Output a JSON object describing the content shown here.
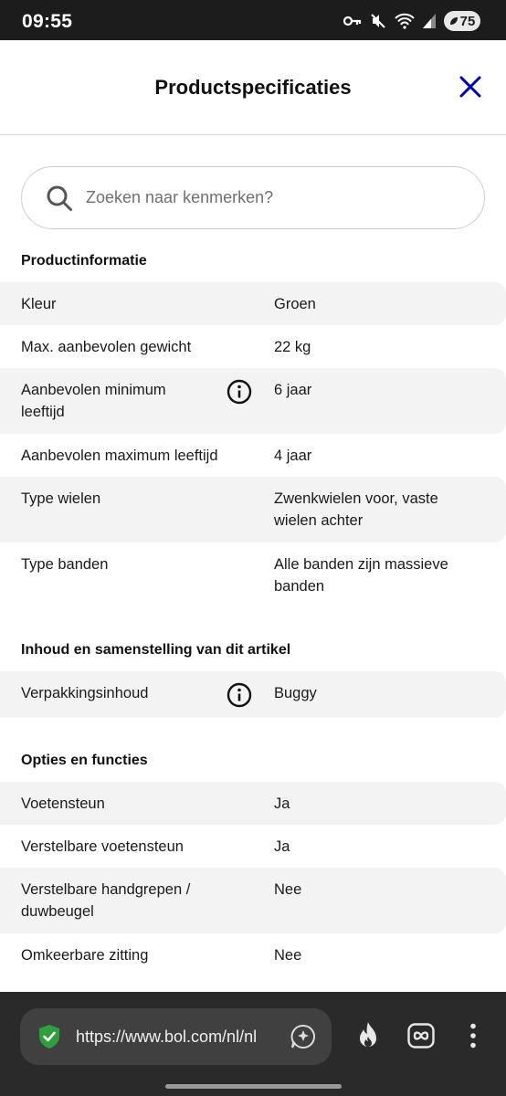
{
  "status_bar": {
    "time": "09:55",
    "battery": "75",
    "icons": [
      "key-icon",
      "mute-icon",
      "wifi-icon",
      "signal-icon",
      "battery-icon"
    ]
  },
  "header": {
    "title": "Productspecificaties",
    "close_icon": "close-icon"
  },
  "search": {
    "placeholder": "Zoeken naar kenmerken?",
    "value": ""
  },
  "sections": [
    {
      "heading": "Productinformatie",
      "rows": [
        {
          "label": "Kleur",
          "value": "Groen",
          "info": false
        },
        {
          "label": "Max. aanbevolen gewicht",
          "value": "22 kg",
          "info": false
        },
        {
          "label": "Aanbevolen minimum leeftijd",
          "value": "6 jaar",
          "info": true
        },
        {
          "label": "Aanbevolen maximum leeftijd",
          "value": "4 jaar",
          "info": false
        },
        {
          "label": "Type wielen",
          "value": "Zwenkwielen voor, vaste wielen achter",
          "info": false
        },
        {
          "label": "Type banden",
          "value": "Alle banden zijn massieve banden",
          "info": false
        }
      ]
    },
    {
      "heading": "Inhoud en samenstelling van dit artikel",
      "rows": [
        {
          "label": "Verpakkingsinhoud",
          "value": "Buggy",
          "info": true
        }
      ]
    },
    {
      "heading": "Opties en functies",
      "rows": [
        {
          "label": "Voetensteun",
          "value": "Ja",
          "info": false
        },
        {
          "label": "Verstelbare voetensteun",
          "value": "Ja",
          "info": false
        },
        {
          "label": "Verstelbare handgrepen / duwbeugel",
          "value": "Nee",
          "info": false
        },
        {
          "label": "Omkeerbare zitting",
          "value": "Nee",
          "info": false
        }
      ]
    }
  ],
  "browser": {
    "url": "https://www.bol.com/nl/nl",
    "icons": [
      "shield-check-icon",
      "assistant-icon",
      "fire-icon",
      "infinity-icon",
      "more-vertical-icon"
    ]
  },
  "colors": {
    "accent": "#0000a4",
    "row_shade": "#f3f3f3",
    "shield_green": "#2e9e3e",
    "status_bar": "#1c1c1c",
    "browser_bar": "#2a2a2a"
  }
}
